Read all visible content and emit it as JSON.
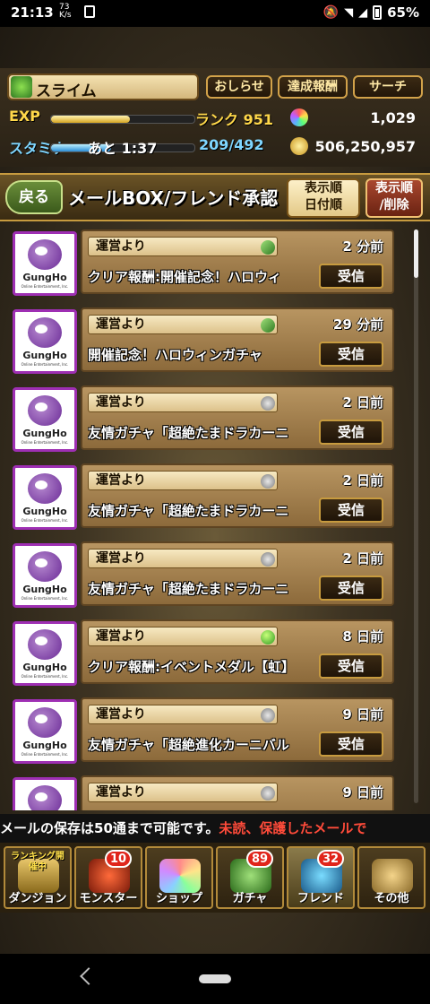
{
  "status": {
    "time": "21:13",
    "speed_top": "73",
    "speed_bottom": "K/s",
    "battery": "65%"
  },
  "player": {
    "name": "スライム",
    "exp_label": "EXP",
    "rank": "ランク 951",
    "exp_fill": 0.55,
    "stamina_label": "スタミナ",
    "stamina_timer": "あと 1:37",
    "stamina_value": "209/492",
    "stamina_fill": 0.42,
    "stones": "1,029",
    "coins": "506,250,957"
  },
  "top_buttons": {
    "news": "おしらせ",
    "achievement": "達成報酬",
    "search": "サーチ"
  },
  "header": {
    "back": "戻る",
    "title": "メールBOX/フレンド承認",
    "sort_line1": "表示順",
    "sort_line2": "日付順",
    "sortbtn_line1": "表示順",
    "sortbtn_line2": "/削除"
  },
  "mails": [
    {
      "sender": "運営より",
      "age": "2 分前",
      "subject": "クリア報酬:開催記念！ハロウィ",
      "icon": "dragon-icon",
      "receive": "受信"
    },
    {
      "sender": "運営より",
      "age": "29 分前",
      "subject": "開催記念！ハロウィンガチャ",
      "icon": "dragon-icon",
      "receive": "受信"
    },
    {
      "sender": "運営より",
      "age": "2 日前",
      "subject": "友情ガチャ「超絶たまドラカーニ",
      "icon": "silver-egg-icon",
      "receive": "受信"
    },
    {
      "sender": "運営より",
      "age": "2 日前",
      "subject": "友情ガチャ「超絶たまドラカーニ",
      "icon": "silver-egg-icon",
      "receive": "受信"
    },
    {
      "sender": "運営より",
      "age": "2 日前",
      "subject": "友情ガチャ「超絶たまドラカーニ",
      "icon": "silver-egg-icon",
      "receive": "受信"
    },
    {
      "sender": "運営より",
      "age": "8 日前",
      "subject": "クリア報酬:イベントメダル【虹】",
      "icon": "green-egg-icon",
      "receive": "受信"
    },
    {
      "sender": "運営より",
      "age": "9 日前",
      "subject": "友情ガチャ「超絶進化カーニバル",
      "icon": "silver-egg-icon",
      "receive": "受信"
    },
    {
      "sender": "運営より",
      "age": "9 日前",
      "subject": "",
      "icon": "silver-egg-icon",
      "receive": ""
    }
  ],
  "gungho": {
    "logo": "GungHo",
    "sub": "Online Entertainment, Inc."
  },
  "notice": {
    "white": "メールの保存は50通まで可能です。",
    "red": "未読、保護したメールで"
  },
  "tabs": [
    {
      "label": "ダンジョン",
      "badge": "",
      "ribbon": "ランキング開催中"
    },
    {
      "label": "モンスター",
      "badge": "10"
    },
    {
      "label": "ショップ",
      "badge": ""
    },
    {
      "label": "ガチャ",
      "badge": "89"
    },
    {
      "label": "フレンド",
      "badge": "32"
    },
    {
      "label": "その他",
      "badge": ""
    }
  ]
}
